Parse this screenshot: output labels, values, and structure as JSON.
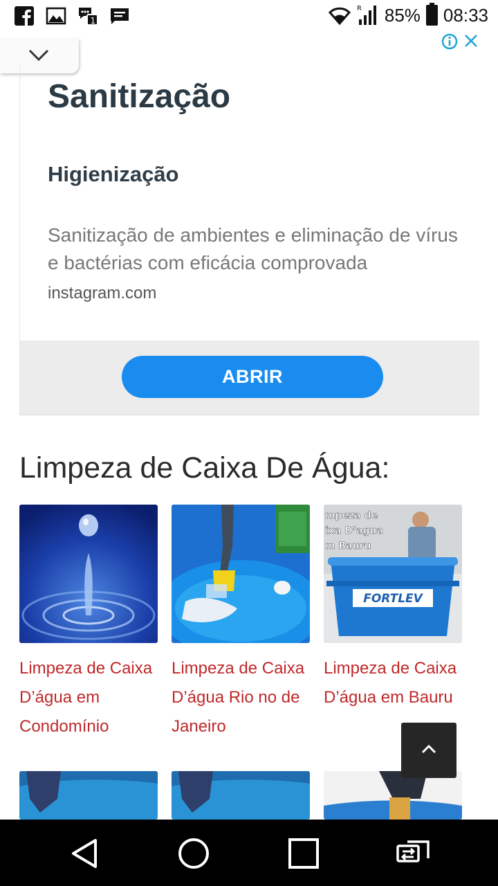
{
  "status_bar": {
    "left_icons": [
      "facebook-icon",
      "image-icon",
      "chat-icon",
      "message-icon"
    ],
    "battery": "85%",
    "time": "08:33"
  },
  "ad": {
    "title": "Sanitização",
    "subtitle": "Higienização",
    "description": "Sanitização de ambientes e eliminação de vírus e bactérias com eficácia comprovada",
    "domain": "instagram.com",
    "cta": "ABRIR",
    "cta_color": "#1a8cf0"
  },
  "section": {
    "title": "Limpeza de Caixa De Água:",
    "link_color": "#c0282a",
    "items": [
      {
        "title": "Limpeza de Caixa D’água em Condomínio",
        "image": "water-drop-image"
      },
      {
        "title": "Limpeza de Caixa D’água Rio no de Janeiro",
        "image": "tank-cleaning-image"
      },
      {
        "title": "Limpeza de Caixa D’água em Bauru",
        "image": "fortlev-tank-image",
        "image_text": [
          "mpeza de",
          "ixa D’agua",
          "m Bauru"
        ],
        "brand": "FORTLEV"
      }
    ]
  },
  "nav": {
    "buttons": [
      "back-icon",
      "home-icon",
      "recents-icon",
      "switch-app-icon"
    ]
  }
}
